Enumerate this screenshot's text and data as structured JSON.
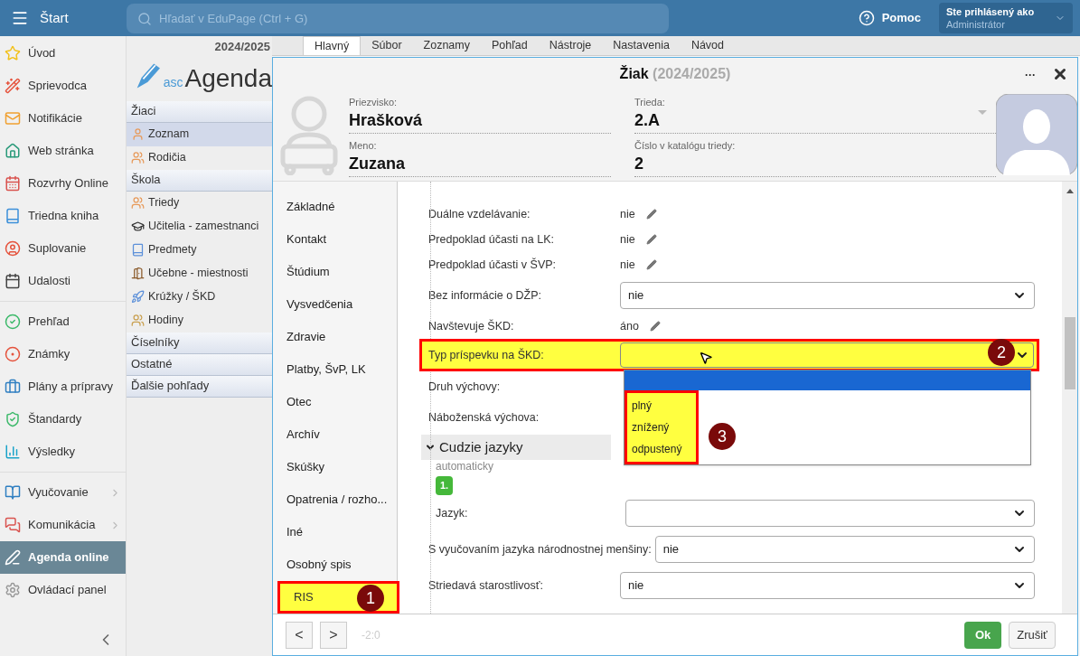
{
  "top_bar": {
    "menu_label": "Štart",
    "search_placeholder": "Hľadať v EduPage (Ctrl + G)",
    "help": "Pomoc",
    "user_caption": "Ste prihlásený ako",
    "user_role": "Administrátor"
  },
  "sidebar": {
    "groups": [
      {
        "items": [
          {
            "label": "Úvod",
            "selected": false,
            "has_submenu": false
          },
          {
            "label": "Sprievodca",
            "selected": false,
            "has_submenu": false
          },
          {
            "label": "Notifikácie",
            "selected": false,
            "has_submenu": false
          },
          {
            "label": "Web stránka",
            "selected": false,
            "has_submenu": false
          },
          {
            "label": "Rozvrhy Online",
            "selected": false,
            "has_submenu": false
          },
          {
            "label": "Triedna kniha",
            "selected": false,
            "has_submenu": false
          },
          {
            "label": "Suplovanie",
            "selected": false,
            "has_submenu": false
          },
          {
            "label": "Udalosti",
            "selected": false,
            "has_submenu": false
          }
        ]
      },
      {
        "items": [
          {
            "label": "Prehľad",
            "selected": false,
            "has_submenu": false
          },
          {
            "label": "Známky",
            "selected": false,
            "has_submenu": false
          },
          {
            "label": "Plány a prípravy",
            "selected": false,
            "has_submenu": false
          },
          {
            "label": "Štandardy",
            "selected": false,
            "has_submenu": false
          },
          {
            "label": "Výsledky",
            "selected": false,
            "has_submenu": false
          }
        ]
      },
      {
        "items": [
          {
            "label": "Vyučovanie",
            "selected": false,
            "has_submenu": true
          },
          {
            "label": "Komunikácia",
            "selected": false,
            "has_submenu": true
          },
          {
            "label": "Agenda online",
            "selected": true,
            "has_submenu": false
          },
          {
            "label": "Ovládací panel",
            "selected": false,
            "has_submenu": false
          }
        ]
      }
    ]
  },
  "agenda": {
    "year": "2024/2025",
    "logo_prefix": "asc",
    "logo_name": "Agenda",
    "sections": [
      {
        "title": "Žiaci",
        "items": [
          {
            "label": "Zoznam",
            "selected": true
          },
          {
            "label": "Rodičia",
            "selected": false
          }
        ]
      },
      {
        "title": "Škola",
        "items": [
          {
            "label": "Triedy",
            "selected": false
          },
          {
            "label": "Učitelia - zamestnanci",
            "selected": false
          },
          {
            "label": "Predmety",
            "selected": false
          },
          {
            "label": "Učebne - miestnosti",
            "selected": false
          },
          {
            "label": "Krúžky / ŠKD",
            "selected": false
          },
          {
            "label": "Hodiny",
            "selected": false
          }
        ]
      },
      {
        "title": "Číselníky"
      },
      {
        "title": "Ostatné"
      },
      {
        "title": "Ďalšie pohľady"
      }
    ]
  },
  "tabs": [
    {
      "label": "Hlavný",
      "selected": true
    },
    {
      "label": "Súbor",
      "selected": false
    },
    {
      "label": "Zoznamy",
      "selected": false
    },
    {
      "label": "Pohľad",
      "selected": false
    },
    {
      "label": "Nástroje",
      "selected": false
    },
    {
      "label": "Nastavenia",
      "selected": false
    },
    {
      "label": "Návod",
      "selected": false
    }
  ],
  "dialog": {
    "title": "Žiak",
    "subtitle": "(2024/2025)",
    "menu_glyph": "···",
    "fields": [
      {
        "label": "Priezvisko:",
        "value": "Hrašková",
        "kind": "text"
      },
      {
        "label": "Trieda:",
        "value": "2.A",
        "kind": "select"
      },
      {
        "label": "Meno:",
        "value": "Zuzana",
        "kind": "text"
      },
      {
        "label": "Číslo v katalógu triedy:",
        "value": "2",
        "kind": "text"
      }
    ],
    "nav": [
      {
        "label": "Základné",
        "selected": false
      },
      {
        "label": "Kontakt",
        "selected": false
      },
      {
        "label": "Štúdium",
        "selected": false
      },
      {
        "label": "Vysvedčenia",
        "selected": false
      },
      {
        "label": "Zdravie",
        "selected": false
      },
      {
        "label": "Platby, ŠvP, LK",
        "selected": false
      },
      {
        "label": "Otec",
        "selected": false
      },
      {
        "label": "Archív",
        "selected": false
      },
      {
        "label": "Skúšky",
        "selected": false
      },
      {
        "label": "Opatrenia / rozho...",
        "selected": false
      },
      {
        "label": "Iné",
        "selected": false
      },
      {
        "label": "Osobný spis",
        "selected": false
      },
      {
        "label": "RIS",
        "selected": true,
        "callout": "1"
      }
    ],
    "rows": [
      {
        "kind": "text",
        "label": "Duálne vzdelávanie:",
        "value": "nie"
      },
      {
        "kind": "text",
        "label": "Predpoklad účasti na LK:",
        "value": "nie"
      },
      {
        "kind": "text",
        "label": "Predpoklad účasti v ŠVP:",
        "value": "nie"
      },
      {
        "kind": "select",
        "label": "Bez informácie o DŽP:",
        "value": "nie"
      },
      {
        "kind": "text",
        "label": "Navštevuje ŠKD:",
        "value": "áno"
      },
      {
        "kind": "open_select",
        "label": "Typ príspevku na ŠKD:",
        "highlighted": true,
        "callout": "2",
        "blank_option_selected": true,
        "options_callout": "3",
        "options": [
          {
            "label": "plný",
            "selected": false
          },
          {
            "label": "znížený",
            "selected": false
          },
          {
            "label": "odpustený",
            "selected": false
          }
        ]
      },
      {
        "kind": "label",
        "label": "Druh výchovy:"
      },
      {
        "kind": "label",
        "label": "Náboženská výchova:"
      },
      {
        "kind": "section",
        "label": "Cudzie jazyky",
        "expanded": true,
        "note": "automaticky",
        "badge": "1.",
        "children": [
          {
            "label": "Jazyk:"
          }
        ]
      },
      {
        "kind": "select",
        "label": "S vyučovaním jazyka národnostnej menšiny:",
        "value": "nie"
      },
      {
        "kind": "select",
        "label": "Striedavá starostlivosť:",
        "value": "nie"
      }
    ],
    "footer": {
      "prev": "<",
      "next": ">",
      "position": "-2:0",
      "ok": "Ok",
      "cancel": "Zrušiť"
    }
  }
}
